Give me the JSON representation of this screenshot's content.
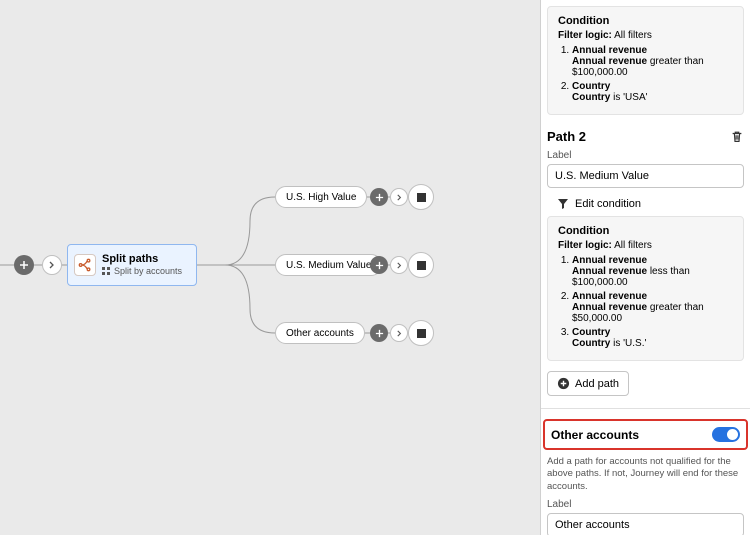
{
  "canvas": {
    "split": {
      "title": "Split paths",
      "subtitle": "Split by accounts"
    },
    "paths": [
      {
        "label": "U.S. High Value"
      },
      {
        "label": "U.S. Medium Value"
      },
      {
        "label": "Other accounts"
      }
    ]
  },
  "panel": {
    "path1": {
      "cond_title": "Condition",
      "filter_label": "Filter logic:",
      "filter_value": "All filters",
      "items": [
        {
          "field": "Annual revenue",
          "sub_field": "Annual revenue",
          "op": "greater than",
          "val": "$100,000.00"
        },
        {
          "field": "Country",
          "sub_field": "Country",
          "op": "is",
          "val": "'USA'"
        }
      ]
    },
    "path2": {
      "title": "Path 2",
      "label_label": "Label",
      "label_value": "U.S. Medium Value",
      "edit_cond": "Edit condition",
      "cond_title": "Condition",
      "filter_label": "Filter logic:",
      "filter_value": "All filters",
      "items": [
        {
          "field": "Annual revenue",
          "sub_field": "Annual revenue",
          "op": "less than",
          "val": "$100,000.00"
        },
        {
          "field": "Annual revenue",
          "sub_field": "Annual revenue",
          "op": "greater than",
          "val": "$50,000.00"
        },
        {
          "field": "Country",
          "sub_field": "Country",
          "op": "is",
          "val": "'U.S.'"
        }
      ]
    },
    "add_path": "Add path",
    "other": {
      "title": "Other accounts",
      "desc": "Add a path for accounts not qualified for the above paths. If not, Journey will end for these accounts.",
      "label_label": "Label",
      "label_value": "Other accounts"
    }
  }
}
